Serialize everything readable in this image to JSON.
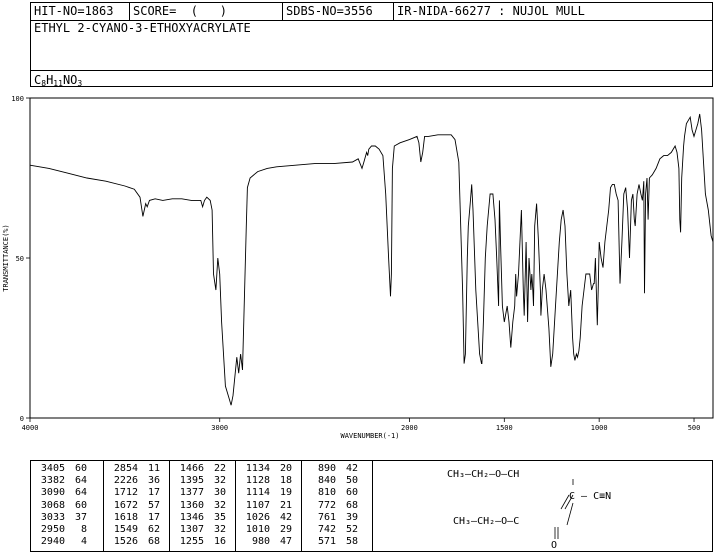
{
  "header": {
    "hit_no": "HIT-NO=1863",
    "score": "SCORE=  (   )",
    "sdbs_no": "SDBS-NO=3556",
    "ir_info": "IR-NIDA-66277 : NUJOL MULL",
    "compound_name": "ETHYL 2-CYANO-3-ETHOXYACRYLATE",
    "formula": {
      "C": "C",
      "C_sub": "8",
      "H": "H",
      "H_sub": "11",
      "NO": "NO",
      "O_sub": "3"
    }
  },
  "chart_data": {
    "type": "line",
    "xlabel": "WAVENUMBER(-1)",
    "ylabel": "TRANSMITTANCE(%)",
    "xlim": [
      4000,
      400
    ],
    "ylim": [
      0,
      100
    ],
    "x_ticks": [
      4000,
      3000,
      2000,
      1500,
      1000,
      500
    ],
    "y_ticks": [
      0,
      50,
      100
    ],
    "series": [
      {
        "points": [
          [
            4000,
            79
          ],
          [
            3900,
            78
          ],
          [
            3800,
            76.5
          ],
          [
            3700,
            75
          ],
          [
            3600,
            74
          ],
          [
            3500,
            72.5
          ],
          [
            3450,
            71.5
          ],
          [
            3420,
            69
          ],
          [
            3405,
            63
          ],
          [
            3390,
            67
          ],
          [
            3382,
            66
          ],
          [
            3370,
            68
          ],
          [
            3340,
            68.5
          ],
          [
            3300,
            68
          ],
          [
            3250,
            68.5
          ],
          [
            3200,
            68.5
          ],
          [
            3150,
            68
          ],
          [
            3100,
            68
          ],
          [
            3090,
            66
          ],
          [
            3080,
            68
          ],
          [
            3068,
            69
          ],
          [
            3050,
            68
          ],
          [
            3040,
            65
          ],
          [
            3033,
            45
          ],
          [
            3020,
            40
          ],
          [
            3010,
            50
          ],
          [
            3000,
            45
          ],
          [
            2990,
            30
          ],
          [
            2970,
            10
          ],
          [
            2950,
            6
          ],
          [
            2940,
            4
          ],
          [
            2930,
            7
          ],
          [
            2910,
            19
          ],
          [
            2900,
            14
          ],
          [
            2890,
            20
          ],
          [
            2880,
            15
          ],
          [
            2860,
            60
          ],
          [
            2854,
            72
          ],
          [
            2840,
            75
          ],
          [
            2800,
            77
          ],
          [
            2750,
            78
          ],
          [
            2700,
            78.5
          ],
          [
            2600,
            79
          ],
          [
            2500,
            79.5
          ],
          [
            2400,
            79.5
          ],
          [
            2300,
            80
          ],
          [
            2270,
            81
          ],
          [
            2250,
            78
          ],
          [
            2240,
            80
          ],
          [
            2226,
            83
          ],
          [
            2220,
            82
          ],
          [
            2214,
            84
          ],
          [
            2200,
            85
          ],
          [
            2180,
            85
          ],
          [
            2160,
            84
          ],
          [
            2140,
            82
          ],
          [
            2125,
            70
          ],
          [
            2110,
            50
          ],
          [
            2100,
            38
          ],
          [
            2095,
            45
          ],
          [
            2090,
            78
          ],
          [
            2080,
            85
          ],
          [
            2050,
            86
          ],
          [
            2000,
            87
          ],
          [
            1960,
            88
          ],
          [
            1950,
            86
          ],
          [
            1940,
            80
          ],
          [
            1930,
            83
          ],
          [
            1920,
            88
          ],
          [
            1900,
            88
          ],
          [
            1850,
            88.5
          ],
          [
            1800,
            88.5
          ],
          [
            1780,
            88.5
          ],
          [
            1760,
            87
          ],
          [
            1740,
            80
          ],
          [
            1730,
            60
          ],
          [
            1720,
            40
          ],
          [
            1712,
            17
          ],
          [
            1705,
            20
          ],
          [
            1695,
            50
          ],
          [
            1690,
            60
          ],
          [
            1680,
            67
          ],
          [
            1672,
            73
          ],
          [
            1665,
            65
          ],
          [
            1650,
            40
          ],
          [
            1640,
            30
          ],
          [
            1630,
            20
          ],
          [
            1620,
            17
          ],
          [
            1618,
            17
          ],
          [
            1610,
            30
          ],
          [
            1600,
            50
          ],
          [
            1590,
            60
          ],
          [
            1575,
            70
          ],
          [
            1560,
            70
          ],
          [
            1549,
            62
          ],
          [
            1540,
            50
          ],
          [
            1530,
            35
          ],
          [
            1526,
            68
          ],
          [
            1520,
            55
          ],
          [
            1510,
            35
          ],
          [
            1500,
            30
          ],
          [
            1485,
            35
          ],
          [
            1475,
            30
          ],
          [
            1466,
            22
          ],
          [
            1455,
            30
          ],
          [
            1445,
            35
          ],
          [
            1440,
            45
          ],
          [
            1435,
            38
          ],
          [
            1425,
            45
          ],
          [
            1410,
            65
          ],
          [
            1400,
            40
          ],
          [
            1395,
            32
          ],
          [
            1385,
            55
          ],
          [
            1377,
            30
          ],
          [
            1370,
            50
          ],
          [
            1360,
            40
          ],
          [
            1355,
            45
          ],
          [
            1350,
            40
          ],
          [
            1346,
            35
          ],
          [
            1340,
            60
          ],
          [
            1330,
            67
          ],
          [
            1320,
            55
          ],
          [
            1310,
            40
          ],
          [
            1307,
            32
          ],
          [
            1300,
            40
          ],
          [
            1290,
            45
          ],
          [
            1280,
            40
          ],
          [
            1265,
            28
          ],
          [
            1255,
            16
          ],
          [
            1245,
            20
          ],
          [
            1230,
            35
          ],
          [
            1210,
            55
          ],
          [
            1200,
            62
          ],
          [
            1190,
            65
          ],
          [
            1180,
            60
          ],
          [
            1170,
            45
          ],
          [
            1160,
            35
          ],
          [
            1150,
            40
          ],
          [
            1140,
            25
          ],
          [
            1134,
            20
          ],
          [
            1128,
            18
          ],
          [
            1120,
            20
          ],
          [
            1114,
            19
          ],
          [
            1107,
            21
          ],
          [
            1100,
            25
          ],
          [
            1090,
            35
          ],
          [
            1080,
            40
          ],
          [
            1070,
            45
          ],
          [
            1050,
            45
          ],
          [
            1040,
            40
          ],
          [
            1030,
            42
          ],
          [
            1026,
            42
          ],
          [
            1020,
            50
          ],
          [
            1010,
            29
          ],
          [
            1005,
            40
          ],
          [
            1000,
            55
          ],
          [
            990,
            50
          ],
          [
            980,
            47
          ],
          [
            970,
            55
          ],
          [
            960,
            60
          ],
          [
            950,
            65
          ],
          [
            940,
            72
          ],
          [
            930,
            73
          ],
          [
            920,
            73
          ],
          [
            910,
            70
          ],
          [
            900,
            68
          ],
          [
            890,
            42
          ],
          [
            880,
            55
          ],
          [
            870,
            70
          ],
          [
            860,
            72
          ],
          [
            850,
            65
          ],
          [
            840,
            50
          ],
          [
            830,
            68
          ],
          [
            822,
            70
          ],
          [
            815,
            62
          ],
          [
            810,
            60
          ],
          [
            800,
            70
          ],
          [
            790,
            73
          ],
          [
            780,
            70
          ],
          [
            772,
            68
          ],
          [
            765,
            74
          ],
          [
            761,
            39
          ],
          [
            755,
            70
          ],
          [
            748,
            75
          ],
          [
            742,
            62
          ],
          [
            735,
            75
          ],
          [
            720,
            76
          ],
          [
            700,
            78
          ],
          [
            680,
            81
          ],
          [
            660,
            82
          ],
          [
            640,
            82
          ],
          [
            620,
            83
          ],
          [
            600,
            85
          ],
          [
            590,
            83
          ],
          [
            580,
            78
          ],
          [
            575,
            62
          ],
          [
            571,
            58
          ],
          [
            565,
            75
          ],
          [
            555,
            85
          ],
          [
            550,
            88
          ],
          [
            540,
            92
          ],
          [
            520,
            94
          ],
          [
            510,
            90
          ],
          [
            500,
            88
          ],
          [
            490,
            90
          ],
          [
            480,
            92
          ],
          [
            470,
            95
          ],
          [
            460,
            90
          ],
          [
            450,
            80
          ],
          [
            440,
            70
          ],
          [
            425,
            65
          ],
          [
            410,
            57
          ],
          [
            400,
            55
          ]
        ]
      }
    ]
  },
  "peak_table": {
    "columns": [
      {
        "wavenumbers": [
          "3405",
          "3382",
          "3090",
          "3068",
          "3033",
          "2950",
          "2940"
        ],
        "transmittance": [
          "60",
          "64",
          "64",
          "60",
          "37",
          "8",
          "4"
        ]
      },
      {
        "wavenumbers": [
          "2854",
          "2226",
          "1712",
          "1672",
          "1618",
          "1549",
          "1526"
        ],
        "transmittance": [
          "11",
          "36",
          "17",
          "57",
          "17",
          "62",
          "68"
        ]
      },
      {
        "wavenumbers": [
          "1466",
          "1395",
          "1377",
          "1360",
          "1346",
          "1307",
          "1255"
        ],
        "transmittance": [
          "22",
          "32",
          "30",
          "32",
          "35",
          "32",
          "16"
        ]
      },
      {
        "wavenumbers": [
          "1134",
          "1128",
          "1114",
          "1107",
          "1026",
          "1010",
          "980"
        ],
        "transmittance": [
          "20",
          "18",
          "19",
          "21",
          "42",
          "29",
          "47"
        ]
      },
      {
        "wavenumbers": [
          "890",
          "840",
          "810",
          "772",
          "761",
          "742",
          "571"
        ],
        "transmittance": [
          "42",
          "50",
          "60",
          "68",
          "39",
          "52",
          "58"
        ]
      }
    ]
  },
  "structure": {
    "line1": "CH₃—CH₂—O—CH",
    "line2": "C — C≡N",
    "line3": "CH₃—CH₂—O—C",
    "oxygen": "O"
  }
}
